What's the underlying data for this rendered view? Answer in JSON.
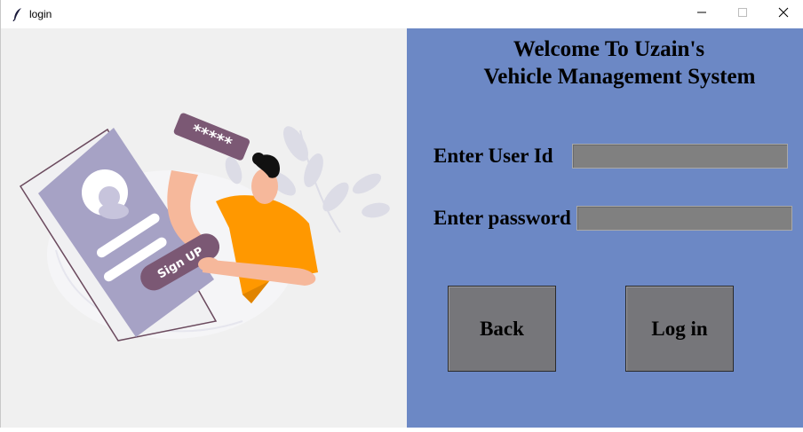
{
  "window": {
    "title": "login",
    "icon": "feather-icon",
    "controls": [
      "minimize-icon",
      "maximize-icon",
      "close-icon"
    ]
  },
  "illustration": {
    "badge_text": "Sign UP",
    "password_text": "*****"
  },
  "form": {
    "heading_line1": "Welcome To Uzain's",
    "heading_line2": "Vehicle Management System",
    "user_label": "Enter User Id",
    "user_value": "",
    "password_label": "Enter password",
    "password_value": "",
    "back_label": "Back",
    "login_label": "Log in"
  },
  "colors": {
    "panel_bg": "#6c88c5",
    "entry_bg": "#808080",
    "button_bg": "#76767a",
    "accent_orange": "#ff9800",
    "accent_purple": "#7b5874"
  }
}
